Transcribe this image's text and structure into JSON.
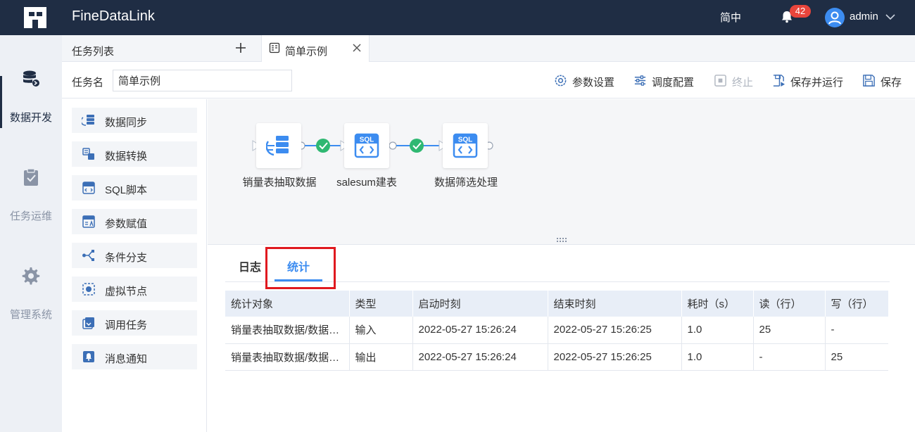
{
  "header": {
    "app_title": "FineDataLink",
    "language": "简中",
    "notification_count": "42",
    "username": "admin"
  },
  "leftnav": {
    "items": [
      {
        "label": "数据开发",
        "icon": "database-icon",
        "active": true
      },
      {
        "label": "任务运维",
        "icon": "clipboard-check-icon",
        "active": false
      },
      {
        "label": "管理系统",
        "icon": "gear-icon",
        "active": false
      }
    ]
  },
  "tabs": {
    "task_list_label": "任务列表",
    "open_tab_label": "简单示例"
  },
  "toolbar": {
    "task_name_label": "任务名",
    "task_name_value": "简单示例",
    "param_settings": "参数设置",
    "schedule_config": "调度配置",
    "stop": "终止",
    "save_and_run": "保存并运行",
    "save": "保存"
  },
  "palette": {
    "items": [
      {
        "label": "数据同步",
        "icon": "data-sync-icon"
      },
      {
        "label": "数据转换",
        "icon": "data-transform-icon"
      },
      {
        "label": "SQL脚本",
        "icon": "sql-script-icon"
      },
      {
        "label": "参数赋值",
        "icon": "param-assign-icon"
      },
      {
        "label": "条件分支",
        "icon": "condition-branch-icon"
      },
      {
        "label": "虚拟节点",
        "icon": "virtual-node-icon"
      },
      {
        "label": "调用任务",
        "icon": "call-task-icon"
      },
      {
        "label": "消息通知",
        "icon": "message-notify-icon"
      }
    ]
  },
  "flow": {
    "nodes": [
      {
        "label": "销量表抽取数据",
        "icon": "data-sync-node-icon"
      },
      {
        "label": "salesum建表",
        "icon": "sql-node-icon"
      },
      {
        "label": "数据筛选处理",
        "icon": "sql-node-icon"
      }
    ]
  },
  "bottom": {
    "tabs": [
      {
        "label": "日志",
        "active": false
      },
      {
        "label": "统计",
        "active": true
      }
    ],
    "table": {
      "columns": [
        "统计对象",
        "类型",
        "启动时刻",
        "结束时刻",
        "耗时（s）",
        "读（行）",
        "写（行）"
      ],
      "rows": [
        [
          "销量表抽取数据/数据同步",
          "输入",
          "2022-05-27 15:26:24",
          "2022-05-27 15:26:25",
          "1.0",
          "25",
          "-"
        ],
        [
          "销量表抽取数据/数据同步",
          "输出",
          "2022-05-27 15:26:24",
          "2022-05-27 15:26:25",
          "1.0",
          "-",
          "25"
        ]
      ]
    }
  },
  "colors": {
    "topbar": "#1f2d44",
    "accent": "#3c8cf0",
    "success": "#2fb872",
    "highlight": "#e0191f",
    "badge": "#e8453c"
  }
}
